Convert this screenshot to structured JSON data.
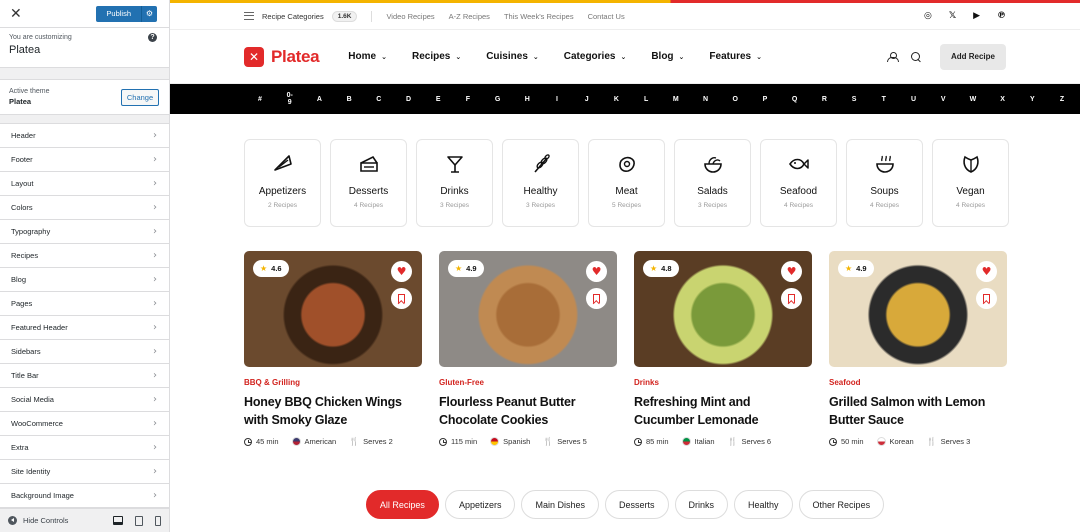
{
  "customizer": {
    "close_glyph": "✕",
    "publish_label": "Publish",
    "gear_glyph": "⚙",
    "customizing_label": "You are customizing",
    "site_name": "Platea",
    "help_glyph": "?",
    "active_theme_label": "Active theme",
    "active_theme_name": "Platea",
    "change_label": "Change",
    "menu": [
      "Header",
      "Footer",
      "Layout",
      "Colors",
      "Typography",
      "Recipes",
      "Blog",
      "Pages",
      "Featured Header",
      "Sidebars",
      "Title Bar",
      "Social Media",
      "WooCommerce",
      "Extra",
      "Site Identity",
      "Background Image"
    ],
    "hide_controls_label": "Hide Controls"
  },
  "topbar": {
    "category_label": "Recipe Categories",
    "count_badge": "1.6K",
    "links": [
      "Video Recipes",
      "A-Z Recipes",
      "This Week's Recipes",
      "Contact Us"
    ],
    "social_icons": [
      "instagram-icon",
      "x-icon",
      "youtube-icon",
      "pinterest-icon"
    ],
    "social_glyphs": [
      "◎",
      "𝕏",
      "▶",
      "℗"
    ]
  },
  "header": {
    "logo_glyph": "✕",
    "logo_text": "Platea",
    "nav": [
      "Home",
      "Recipes",
      "Cuisines",
      "Categories",
      "Blog",
      "Features"
    ],
    "caret_glyph": "⌄",
    "add_recipe_label": "Add Recipe"
  },
  "alphabet": [
    "#",
    "0-9",
    "A",
    "B",
    "C",
    "D",
    "E",
    "F",
    "G",
    "H",
    "I",
    "J",
    "K",
    "L",
    "M",
    "N",
    "O",
    "P",
    "Q",
    "R",
    "S",
    "T",
    "U",
    "V",
    "W",
    "X",
    "Y",
    "Z"
  ],
  "categories": [
    {
      "name": "Appetizers",
      "count": "2 Recipes",
      "icon": "pizza-slice-icon"
    },
    {
      "name": "Desserts",
      "count": "4 Recipes",
      "icon": "cake-icon"
    },
    {
      "name": "Drinks",
      "count": "3 Recipes",
      "icon": "cocktail-icon"
    },
    {
      "name": "Healthy",
      "count": "3 Recipes",
      "icon": "wheat-icon"
    },
    {
      "name": "Meat",
      "count": "5 Recipes",
      "icon": "steak-icon"
    },
    {
      "name": "Salads",
      "count": "3 Recipes",
      "icon": "salad-bowl-icon"
    },
    {
      "name": "Seafood",
      "count": "4 Recipes",
      "icon": "fish-icon"
    },
    {
      "name": "Soups",
      "count": "4 Recipes",
      "icon": "soup-bowl-icon"
    },
    {
      "name": "Vegan",
      "count": "4 Recipes",
      "icon": "leaf-icon"
    }
  ],
  "recipes": [
    {
      "rating": "4.6",
      "tag": "BBQ & Grilling",
      "title": "Honey BBQ Chicken Wings with Smoky Glaze",
      "time": "45 min",
      "cuisine": "American",
      "serves": "Serves 2",
      "flag_colors": [
        "#3c3b6e",
        "#b22234"
      ],
      "image_colors": [
        "#6b4a2e",
        "#3a2414",
        "#a0502a"
      ]
    },
    {
      "rating": "4.9",
      "tag": "Gluten-Free",
      "title": "Flourless Peanut Butter Chocolate Cookies",
      "time": "115 min",
      "cuisine": "Spanish",
      "serves": "Serves 5",
      "flag_colors": [
        "#c60b1e",
        "#ffc400"
      ],
      "image_colors": [
        "#8e8a86",
        "#c08a52",
        "#a86d38"
      ]
    },
    {
      "rating": "4.8",
      "tag": "Drinks",
      "title": "Refreshing Mint and Cucumber Lemonade",
      "time": "85 min",
      "cuisine": "Italian",
      "serves": "Serves 6",
      "flag_colors": [
        "#009246",
        "#ce2b37"
      ],
      "image_colors": [
        "#5a3d24",
        "#c9d470",
        "#7a9a3a"
      ]
    },
    {
      "rating": "4.9",
      "tag": "Seafood",
      "title": "Grilled Salmon with Lemon Butter Sauce",
      "time": "50 min",
      "cuisine": "Korean",
      "serves": "Serves 3",
      "flag_colors": [
        "#ffffff",
        "#cd2e3a"
      ],
      "image_colors": [
        "#e9dcc2",
        "#2b2b2b",
        "#d8a93a"
      ]
    }
  ],
  "recipe_glyphs": {
    "star": "★",
    "heart": "♥",
    "fork": "🍴"
  },
  "filters": [
    "All Recipes",
    "Appetizers",
    "Main Dishes",
    "Desserts",
    "Drinks",
    "Healthy",
    "Other Recipes"
  ],
  "colors": {
    "accent": "#e22a2a",
    "publish": "#2271b1",
    "star": "#f4b400"
  }
}
